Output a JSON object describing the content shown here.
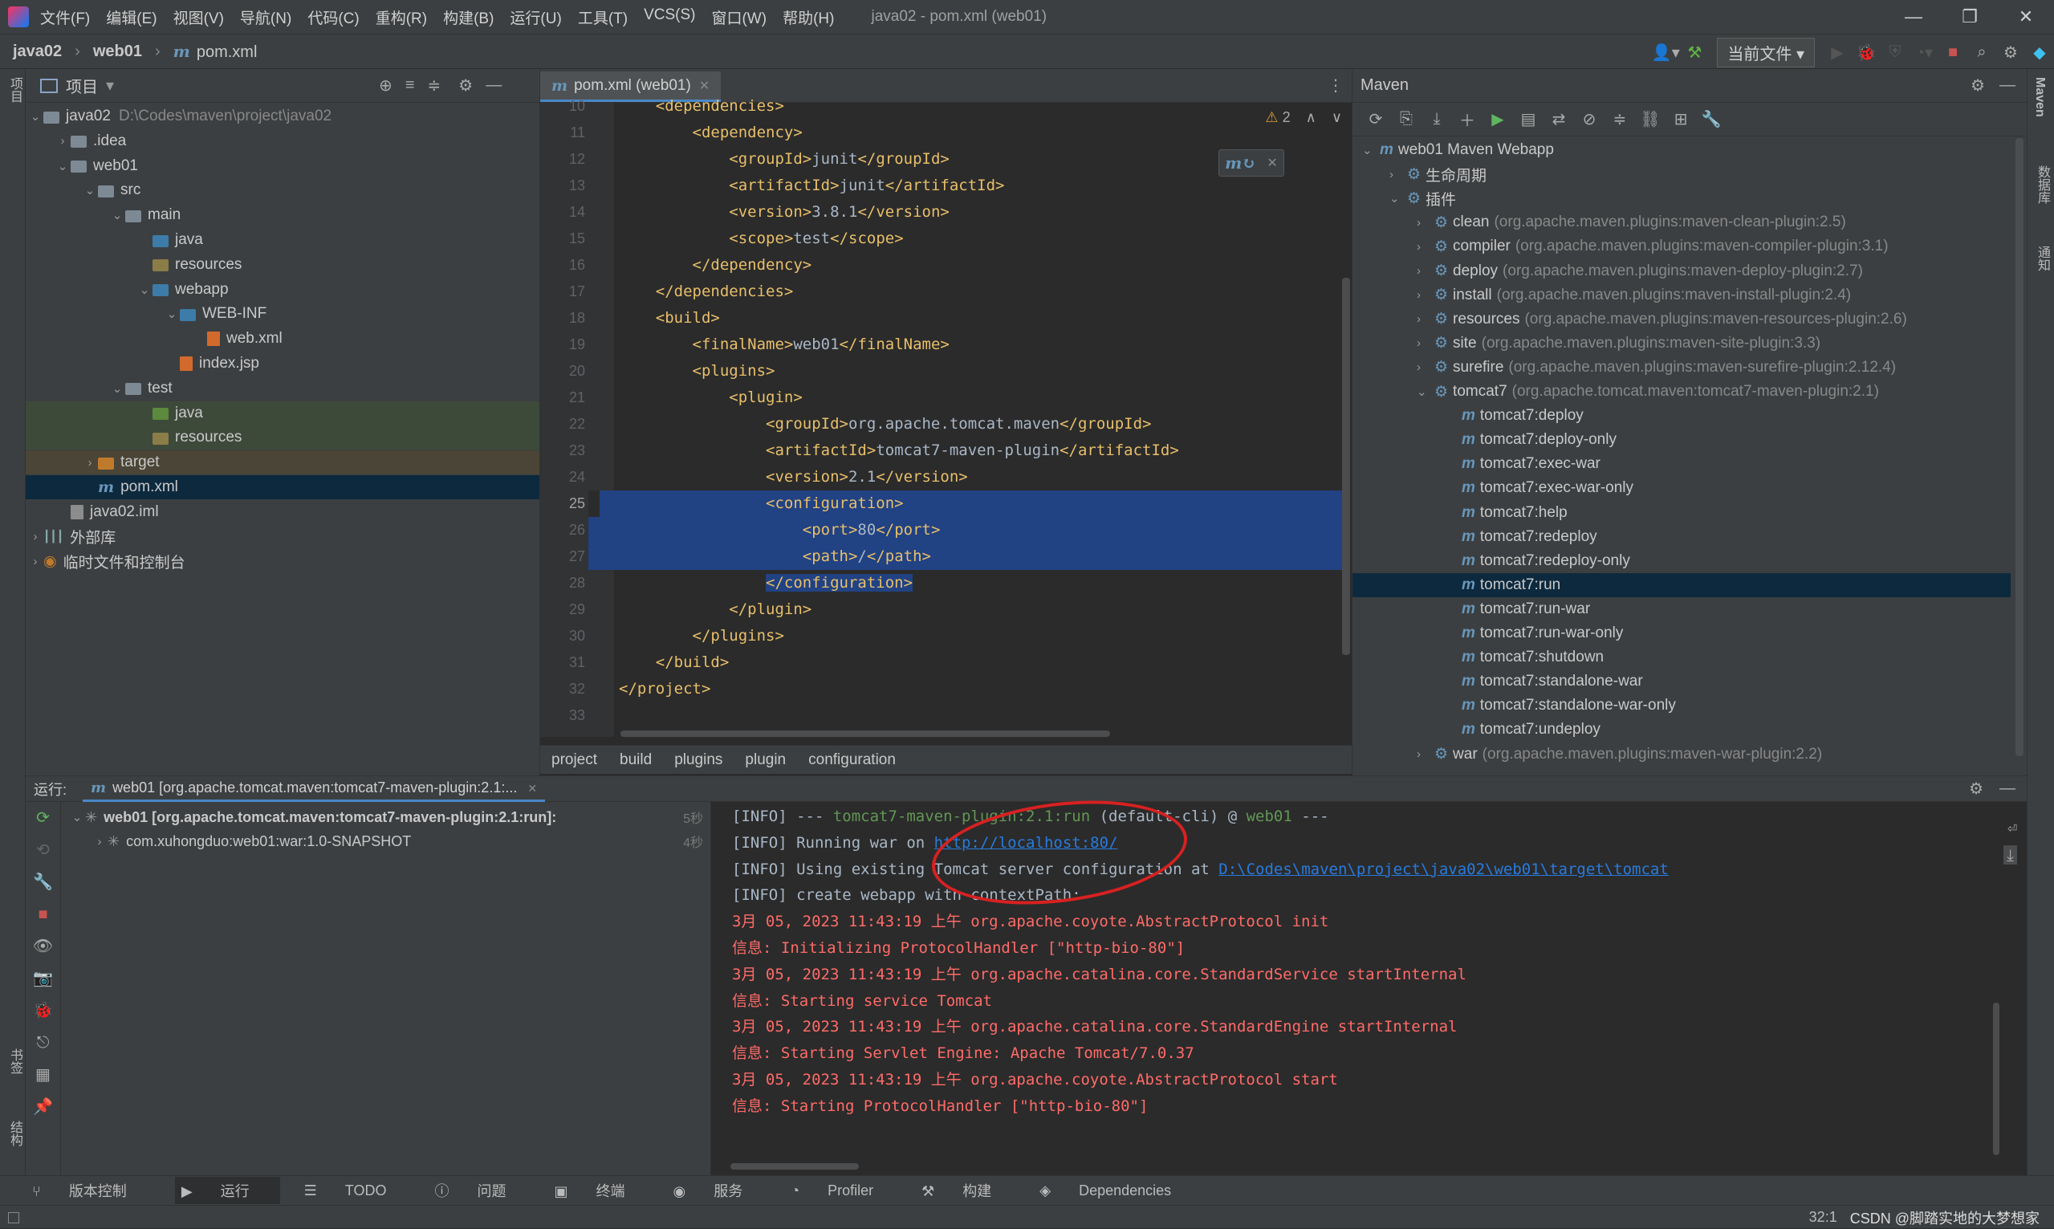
{
  "titlebar": {
    "menu": [
      "文件(F)",
      "编辑(E)",
      "视图(V)",
      "导航(N)",
      "代码(C)",
      "重构(R)",
      "构建(B)",
      "运行(U)",
      "工具(T)",
      "VCS(S)",
      "窗口(W)",
      "帮助(H)"
    ],
    "title": "java02 - pom.xml (web01)"
  },
  "breadcrumb": {
    "project": "java02",
    "module": "web01",
    "file": "pom.xml"
  },
  "toolbar": {
    "run_config": "当前文件"
  },
  "left_strip": {
    "project_tab": "项目",
    "bookmarks_tab": "书签",
    "structure_tab": "结构"
  },
  "right_strip": {
    "maven_tab": "Maven",
    "database_tab": "数据库",
    "notifications_tab": "通知"
  },
  "project_panel": {
    "title": "项目",
    "tree": [
      {
        "label": "java02",
        "hint": "D:\\Codes\\maven\\project\\java02",
        "level": 0,
        "icon": "folder",
        "open": true
      },
      {
        "label": ".idea",
        "level": 1,
        "icon": "folder",
        "open": false
      },
      {
        "label": "web01",
        "level": 1,
        "icon": "folder",
        "open": true
      },
      {
        "label": "src",
        "level": 2,
        "icon": "folder",
        "open": true
      },
      {
        "label": "main",
        "level": 3,
        "icon": "folder",
        "open": true
      },
      {
        "label": "java",
        "level": 4,
        "icon": "folder-blue"
      },
      {
        "label": "resources",
        "level": 4,
        "icon": "folder-res"
      },
      {
        "label": "webapp",
        "level": 4,
        "icon": "folder-blue",
        "open": true
      },
      {
        "label": "WEB-INF",
        "level": 5,
        "icon": "folder-blue",
        "open": true
      },
      {
        "label": "web.xml",
        "level": 6,
        "icon": "xml-file"
      },
      {
        "label": "index.jsp",
        "level": 5,
        "icon": "jsp-file"
      },
      {
        "label": "test",
        "level": 3,
        "icon": "folder",
        "open": true
      },
      {
        "label": "java",
        "level": 4,
        "icon": "folder-green"
      },
      {
        "label": "resources",
        "level": 4,
        "icon": "folder-res"
      },
      {
        "label": "target",
        "level": 2,
        "icon": "folder-orange",
        "open": false
      },
      {
        "label": "pom.xml",
        "level": 2,
        "icon": "maven-file",
        "selected": true
      },
      {
        "label": "java02.iml",
        "level": 1,
        "icon": "iml-file"
      },
      {
        "label": "外部库",
        "level": 0,
        "icon": "library",
        "open": false
      },
      {
        "label": "临时文件和控制台",
        "level": 0,
        "icon": "scratch",
        "open": false
      }
    ]
  },
  "editor": {
    "tab": "pom.xml (web01)",
    "warnings": "2",
    "lines": [
      {
        "n": "10",
        "code": "    <dependencies>"
      },
      {
        "n": "11",
        "code": "        <dependency>"
      },
      {
        "n": "12",
        "code": "            <groupId>junit</groupId>"
      },
      {
        "n": "13",
        "code": "            <artifactId>junit</artifactId>"
      },
      {
        "n": "14",
        "code": "            <version>3.8.1</version>"
      },
      {
        "n": "15",
        "code": "            <scope>test</scope>"
      },
      {
        "n": "16",
        "code": "        </dependency>"
      },
      {
        "n": "17",
        "code": "    </dependencies>"
      },
      {
        "n": "18",
        "code": "    <build>"
      },
      {
        "n": "19",
        "code": "        <finalName>web01</finalName>"
      },
      {
        "n": "20",
        "code": "        <plugins>"
      },
      {
        "n": "21",
        "code": "            <plugin>"
      },
      {
        "n": "22",
        "code": "                <groupId>org.apache.tomcat.maven</groupId>"
      },
      {
        "n": "23",
        "code": "                <artifactId>tomcat7-maven-plugin</artifactId>"
      },
      {
        "n": "24",
        "code": "                <version>2.1</version>"
      },
      {
        "n": "25",
        "code": "                <configuration>"
      },
      {
        "n": "26",
        "code": "                    <port>80</port>"
      },
      {
        "n": "27",
        "code": "                    <path>/</path>"
      },
      {
        "n": "28",
        "code": "                </configuration>"
      },
      {
        "n": "29",
        "code": "            </plugin>"
      },
      {
        "n": "30",
        "code": "        </plugins>"
      },
      {
        "n": "31",
        "code": "    </build>"
      },
      {
        "n": "32",
        "code": "</project>"
      },
      {
        "n": "33",
        "code": ""
      }
    ],
    "breadcrumb": [
      "project",
      "build",
      "plugins",
      "plugin",
      "configuration"
    ]
  },
  "maven_panel": {
    "title": "Maven",
    "root": "web01 Maven Webapp",
    "lifecycle": "生命周期",
    "plugins_label": "插件",
    "plugins": [
      {
        "name": "clean",
        "coord": "(org.apache.maven.plugins:maven-clean-plugin:2.5)"
      },
      {
        "name": "compiler",
        "coord": "(org.apache.maven.plugins:maven-compiler-plugin:3.1)"
      },
      {
        "name": "deploy",
        "coord": "(org.apache.maven.plugins:maven-deploy-plugin:2.7)"
      },
      {
        "name": "install",
        "coord": "(org.apache.maven.plugins:maven-install-plugin:2.4)"
      },
      {
        "name": "resources",
        "coord": "(org.apache.maven.plugins:maven-resources-plugin:2.6)"
      },
      {
        "name": "site",
        "coord": "(org.apache.maven.plugins:maven-site-plugin:3.3)"
      },
      {
        "name": "surefire",
        "coord": "(org.apache.maven.plugins:maven-surefire-plugin:2.12.4)"
      },
      {
        "name": "tomcat7",
        "coord": "(org.apache.tomcat.maven:tomcat7-maven-plugin:2.1)"
      }
    ],
    "goals": [
      "tomcat7:deploy",
      "tomcat7:deploy-only",
      "tomcat7:exec-war",
      "tomcat7:exec-war-only",
      "tomcat7:help",
      "tomcat7:redeploy",
      "tomcat7:redeploy-only",
      "tomcat7:run",
      "tomcat7:run-war",
      "tomcat7:run-war-only",
      "tomcat7:shutdown",
      "tomcat7:standalone-war",
      "tomcat7:standalone-war-only",
      "tomcat7:undeploy"
    ],
    "selected_goal": "tomcat7:run",
    "war": {
      "name": "war",
      "coord": "(org.apache.maven.plugins:maven-war-plugin:2.2)"
    }
  },
  "run_panel": {
    "label": "运行:",
    "tab": "web01 [org.apache.tomcat.maven:tomcat7-maven-plugin:2.1:...",
    "tree": [
      {
        "label": "web01 [org.apache.tomcat.maven:tomcat7-maven-plugin:2.1:run]:",
        "time": "5秒"
      },
      {
        "label": "com.xuhongduo:web01:war:1.0-SNAPSHOT",
        "time": "4秒"
      }
    ],
    "console": [
      {
        "parts": [
          {
            "t": "[INFO]",
            "c": "info"
          },
          {
            "t": " --- ",
            "c": "info"
          },
          {
            "t": "tomcat7-maven-plugin:2.1:run",
            "c": "green"
          },
          {
            "t": " (default-cli) @ ",
            "c": "info"
          },
          {
            "t": "web01",
            "c": "green"
          },
          {
            "t": " ---",
            "c": "info"
          }
        ]
      },
      {
        "parts": [
          {
            "t": "[INFO]",
            "c": "info"
          },
          {
            "t": " Running war on ",
            "c": "info"
          },
          {
            "t": "http://localhost:80/",
            "c": "link"
          }
        ]
      },
      {
        "parts": [
          {
            "t": "[INFO]",
            "c": "info"
          },
          {
            "t": " Using existing Tomcat server configuration at ",
            "c": "info"
          },
          {
            "t": "D:\\Codes\\maven\\project\\java02\\web01\\target\\tomcat",
            "c": "link"
          }
        ]
      },
      {
        "parts": [
          {
            "t": "[INFO]",
            "c": "info"
          },
          {
            "t": " create webapp with contextPath:",
            "c": "info"
          }
        ]
      },
      {
        "parts": [
          {
            "t": "3月 05, 2023 11:43:19 上午 org.apache.coyote.AbstractProtocol init",
            "c": "red"
          }
        ]
      },
      {
        "parts": [
          {
            "t": "信息: Initializing ProtocolHandler [\"http-bio-80\"]",
            "c": "red"
          }
        ]
      },
      {
        "parts": [
          {
            "t": "3月 05, 2023 11:43:19 上午 org.apache.catalina.core.StandardService startInternal",
            "c": "red"
          }
        ]
      },
      {
        "parts": [
          {
            "t": "信息: Starting service Tomcat",
            "c": "red"
          }
        ]
      },
      {
        "parts": [
          {
            "t": "3月 05, 2023 11:43:19 上午 org.apache.catalina.core.StandardEngine startInternal",
            "c": "red"
          }
        ]
      },
      {
        "parts": [
          {
            "t": "信息: Starting Servlet Engine: Apache Tomcat/7.0.37",
            "c": "red"
          }
        ]
      },
      {
        "parts": [
          {
            "t": "3月 05, 2023 11:43:19 上午 org.apache.coyote.AbstractProtocol start",
            "c": "red"
          }
        ]
      },
      {
        "parts": [
          {
            "t": "信息: Starting ProtocolHandler [\"http-bio-80\"]",
            "c": "red"
          }
        ]
      }
    ]
  },
  "bottom_tabs": [
    "版本控制",
    "运行",
    "TODO",
    "问题",
    "终端",
    "服务",
    "Profiler",
    "构建",
    "Dependencies"
  ],
  "active_bottom_tab": "运行",
  "status": {
    "position": "32:1",
    "watermark": "CSDN @脚踏实地的大梦想家"
  },
  "colors": {
    "accent": "#4a88c7",
    "selection": "#214283",
    "annotation": "#d82121"
  }
}
